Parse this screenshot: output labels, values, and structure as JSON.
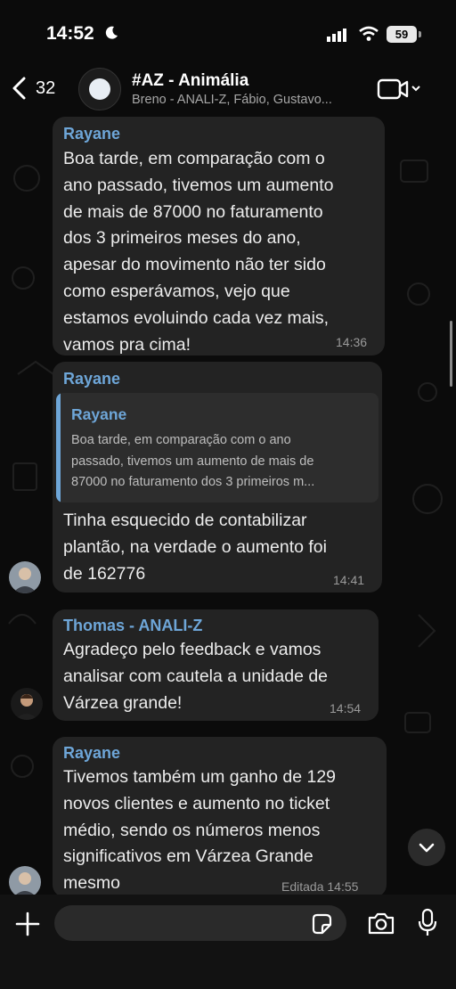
{
  "status_bar": {
    "time": "14:52",
    "battery": "59"
  },
  "header": {
    "back_count": "32",
    "title": "#AZ - Animália",
    "subtitle": "Breno - ANALI-Z, Fábio, Gustavo..."
  },
  "messages": [
    {
      "sender": "Rayane",
      "lines": [
        "Boa tarde, em comparação com o",
        "ano passado, tivemos um aumento",
        "de mais de 87000 no faturamento",
        "dos 3 primeiros meses do ano,",
        "apesar do movimento não ter sido",
        "como esperávamos, vejo que",
        "estamos evoluindo cada vez mais,",
        "vamos pra cima!"
      ],
      "time": "14:36"
    },
    {
      "sender": "Rayane",
      "quote": {
        "sender": "Rayane",
        "lines": [
          "Boa tarde, em comparação com o ano",
          "passado, tivemos um aumento de mais de",
          "87000 no faturamento dos 3 primeiros m..."
        ]
      },
      "lines": [
        "Tinha esquecido de contabilizar",
        "plantão, na verdade o aumento foi",
        "de 162776"
      ],
      "time": "14:41"
    },
    {
      "sender": "Thomas - ANALI-Z",
      "lines": [
        "Agradeço pelo feedback e vamos",
        "analisar com cautela a unidade de",
        "Várzea grande!"
      ],
      "time": "14:54"
    },
    {
      "sender": "Rayane",
      "lines": [
        "Tivemos também um ganho de 129",
        "novos clientes e aumento no ticket",
        "médio, sendo os números menos",
        "significativos em Várzea Grande",
        "mesmo"
      ],
      "time": "Editada 14:55"
    }
  ],
  "input": {
    "placeholder": ""
  },
  "colors": {
    "sender_blue": "#6ea6d8",
    "bubble": "#232323",
    "background": "#0b0b0b"
  }
}
